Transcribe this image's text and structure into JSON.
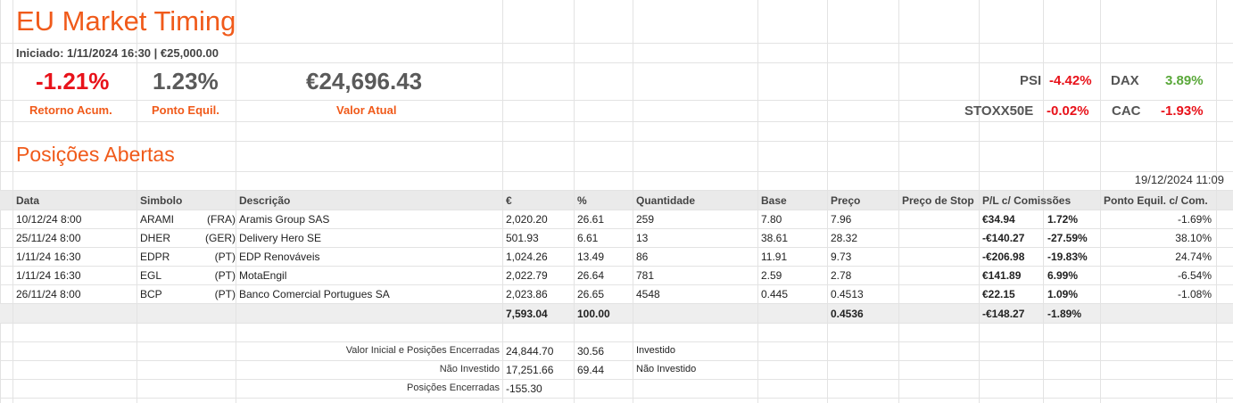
{
  "header": {
    "title": "EU Market Timing",
    "subtitle": "Iniciado: 1/11/2024 16:30 |  €25,000.00"
  },
  "kpis": [
    {
      "value": "-1.21%",
      "label": "Retorno Acum.",
      "color": "#e8121a"
    },
    {
      "value": "1.23%",
      "label": "Ponto Equil.",
      "color": "#5a5a5a"
    },
    {
      "value": "€24,696.43",
      "label": "Valor Atual",
      "color": "#5a5a5a"
    }
  ],
  "indices": [
    {
      "name": "PSI",
      "value": "-4.42%"
    },
    {
      "name": "DAX",
      "value": "3.89%"
    },
    {
      "name": "STOXX50E",
      "value": "-0.02%"
    },
    {
      "name": "CAC",
      "value": "-1.93%"
    }
  ],
  "section": {
    "title": "Posições Abertas",
    "timestamp": "19/12/2024 11:09"
  },
  "table": {
    "headers": {
      "data": "Data",
      "simbolo": "Simbolo",
      "descricao": "Descrição",
      "eur": "€",
      "pct": "%",
      "quantidade": "Quantidade",
      "base": "Base",
      "preco": "Preço",
      "stop": "Preço de Stop",
      "pl": "P/L c/ Comissões",
      "ponto": "Ponto Equil. c/ Com."
    },
    "rows": [
      {
        "data": "10/12/24 8:00",
        "simbolo": "ARAMI",
        "mercado": "(FRA)",
        "descricao": "Aramis Group SAS",
        "eur": "2,020.20",
        "pct": "26.61",
        "quantidade": "259",
        "base": "7.80",
        "preco": "7.96",
        "stop": "",
        "pl": "€34.94",
        "plpct": "1.72%",
        "ponto": "-1.69%",
        "positive": true
      },
      {
        "data": "25/11/24 8:00",
        "simbolo": "DHER",
        "mercado": "(GER)",
        "descricao": "Delivery Hero SE",
        "eur": "501.93",
        "pct": "6.61",
        "quantidade": "13",
        "base": "38.61",
        "preco": "28.32",
        "stop": "",
        "pl": "-€140.27",
        "plpct": "-27.59%",
        "ponto": "38.10%",
        "positive": false
      },
      {
        "data": "1/11/24 16:30",
        "simbolo": "EDPR",
        "mercado": "(PT)",
        "descricao": "EDP Renováveis",
        "eur": "1,024.26",
        "pct": "13.49",
        "quantidade": "86",
        "base": "11.91",
        "preco": "9.73",
        "stop": "",
        "pl": "-€206.98",
        "plpct": "-19.83%",
        "ponto": "24.74%",
        "positive": false
      },
      {
        "data": "1/11/24 16:30",
        "simbolo": "EGL",
        "mercado": "(PT)",
        "descricao": "MotaEngil",
        "eur": "2,022.79",
        "pct": "26.64",
        "quantidade": "781",
        "base": "2.59",
        "preco": "2.78",
        "stop": "",
        "pl": "€141.89",
        "plpct": "6.99%",
        "ponto": "-6.54%",
        "positive": true
      },
      {
        "data": "26/11/24 8:00",
        "simbolo": "BCP",
        "mercado": "(PT)",
        "descricao": "Banco Comercial Portugues SA",
        "eur": "2,023.86",
        "pct": "26.65",
        "quantidade": "4548",
        "base": "0.445",
        "preco": "0.4513",
        "stop": "",
        "pl": "€22.15",
        "plpct": "1.09%",
        "ponto": "-1.08%",
        "positive": true
      }
    ],
    "totals": {
      "eur": "7,593.04",
      "pct": "100.00",
      "preco": "0.4536",
      "pl": "-€148.27",
      "plpct": "-1.89%"
    }
  },
  "summary": [
    {
      "label": "Valor Inicial e Posições Encerradas",
      "value": "24,844.70",
      "pct": "30.56",
      "note": "Investido",
      "neg": false
    },
    {
      "label": "Não Investido",
      "value": "17,251.66",
      "pct": "69.44",
      "note": "Não Investido",
      "neg": false
    },
    {
      "label": "Posições Encerradas",
      "value": "-155.30",
      "pct": "",
      "note": "",
      "neg": true
    }
  ],
  "colors": {
    "accent": "#f05a1a",
    "negative": "#e8121a",
    "positive": "#5aa83a"
  }
}
